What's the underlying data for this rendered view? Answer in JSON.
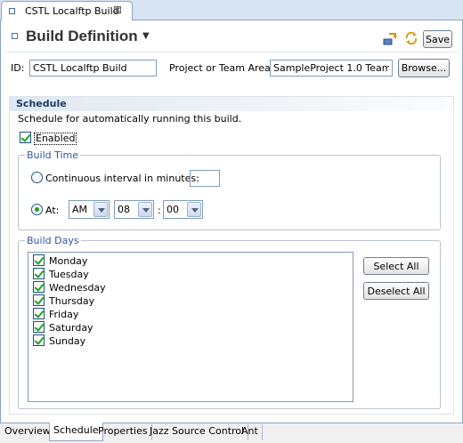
{
  "editor_tab": {
    "label": "CSTL Localftp Build",
    "close": "⊠"
  },
  "header": {
    "title": "Build Definition",
    "save_label": "Save"
  },
  "id_row": {
    "id_label": "ID:",
    "id_value": "CSTL Localftp Build",
    "area_label": "Project or Team Area:",
    "area_value": "SampleProject 1.0 Team",
    "browse_label": "Browse..."
  },
  "schedule": {
    "title": "Schedule",
    "description": "Schedule for automatically running this build.",
    "enabled_label": "Enabled",
    "enabled": true
  },
  "build_time": {
    "title": "Build Time",
    "continuous_label": "Continuous interval in minutes:",
    "continuous_value": "",
    "at_label": "At:",
    "ampm": "AM",
    "hour": "08",
    "colon": ":",
    "minute": "00",
    "selected": "at"
  },
  "build_days": {
    "title": "Build Days",
    "days": [
      {
        "label": "Monday",
        "checked": true
      },
      {
        "label": "Tuesday",
        "checked": true
      },
      {
        "label": "Wednesday",
        "checked": true
      },
      {
        "label": "Thursday",
        "checked": true
      },
      {
        "label": "Friday",
        "checked": true
      },
      {
        "label": "Saturday",
        "checked": true
      },
      {
        "label": "Sunday",
        "checked": true
      }
    ],
    "select_all_label": "Select All",
    "deselect_all_label": "Deselect All"
  },
  "bottom_tabs": [
    {
      "label": "Overview"
    },
    {
      "label": "Schedule",
      "active": true
    },
    {
      "label": "Properties"
    },
    {
      "label": "Jazz Source Control"
    },
    {
      "label": "Ant"
    }
  ],
  "icons": {
    "refresh": "refresh-icon",
    "sync": "sync-icon"
  },
  "colors": {
    "accent": "#2d57a4",
    "check": "#21a121",
    "tab_border": "#8ea5c6"
  }
}
